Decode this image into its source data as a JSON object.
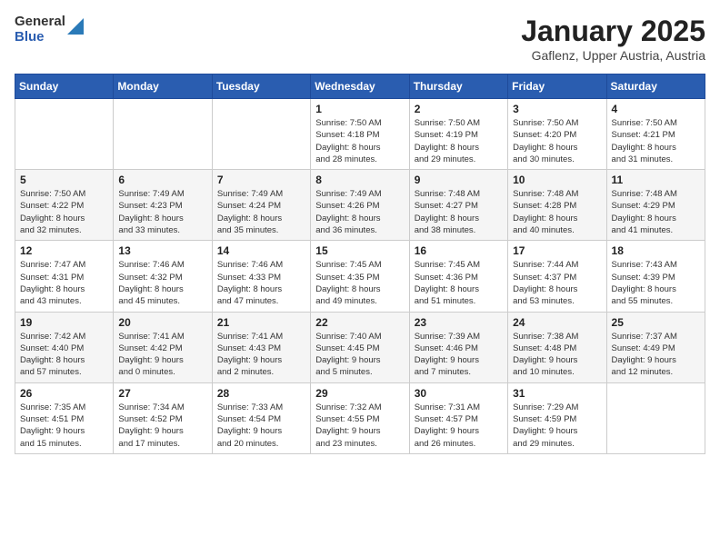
{
  "logo": {
    "general": "General",
    "blue": "Blue"
  },
  "header": {
    "title": "January 2025",
    "subtitle": "Gaflenz, Upper Austria, Austria"
  },
  "days_of_week": [
    "Sunday",
    "Monday",
    "Tuesday",
    "Wednesday",
    "Thursday",
    "Friday",
    "Saturday"
  ],
  "weeks": [
    [
      {
        "day": "",
        "info": ""
      },
      {
        "day": "",
        "info": ""
      },
      {
        "day": "",
        "info": ""
      },
      {
        "day": "1",
        "info": "Sunrise: 7:50 AM\nSunset: 4:18 PM\nDaylight: 8 hours\nand 28 minutes."
      },
      {
        "day": "2",
        "info": "Sunrise: 7:50 AM\nSunset: 4:19 PM\nDaylight: 8 hours\nand 29 minutes."
      },
      {
        "day": "3",
        "info": "Sunrise: 7:50 AM\nSunset: 4:20 PM\nDaylight: 8 hours\nand 30 minutes."
      },
      {
        "day": "4",
        "info": "Sunrise: 7:50 AM\nSunset: 4:21 PM\nDaylight: 8 hours\nand 31 minutes."
      }
    ],
    [
      {
        "day": "5",
        "info": "Sunrise: 7:50 AM\nSunset: 4:22 PM\nDaylight: 8 hours\nand 32 minutes."
      },
      {
        "day": "6",
        "info": "Sunrise: 7:49 AM\nSunset: 4:23 PM\nDaylight: 8 hours\nand 33 minutes."
      },
      {
        "day": "7",
        "info": "Sunrise: 7:49 AM\nSunset: 4:24 PM\nDaylight: 8 hours\nand 35 minutes."
      },
      {
        "day": "8",
        "info": "Sunrise: 7:49 AM\nSunset: 4:26 PM\nDaylight: 8 hours\nand 36 minutes."
      },
      {
        "day": "9",
        "info": "Sunrise: 7:48 AM\nSunset: 4:27 PM\nDaylight: 8 hours\nand 38 minutes."
      },
      {
        "day": "10",
        "info": "Sunrise: 7:48 AM\nSunset: 4:28 PM\nDaylight: 8 hours\nand 40 minutes."
      },
      {
        "day": "11",
        "info": "Sunrise: 7:48 AM\nSunset: 4:29 PM\nDaylight: 8 hours\nand 41 minutes."
      }
    ],
    [
      {
        "day": "12",
        "info": "Sunrise: 7:47 AM\nSunset: 4:31 PM\nDaylight: 8 hours\nand 43 minutes."
      },
      {
        "day": "13",
        "info": "Sunrise: 7:46 AM\nSunset: 4:32 PM\nDaylight: 8 hours\nand 45 minutes."
      },
      {
        "day": "14",
        "info": "Sunrise: 7:46 AM\nSunset: 4:33 PM\nDaylight: 8 hours\nand 47 minutes."
      },
      {
        "day": "15",
        "info": "Sunrise: 7:45 AM\nSunset: 4:35 PM\nDaylight: 8 hours\nand 49 minutes."
      },
      {
        "day": "16",
        "info": "Sunrise: 7:45 AM\nSunset: 4:36 PM\nDaylight: 8 hours\nand 51 minutes."
      },
      {
        "day": "17",
        "info": "Sunrise: 7:44 AM\nSunset: 4:37 PM\nDaylight: 8 hours\nand 53 minutes."
      },
      {
        "day": "18",
        "info": "Sunrise: 7:43 AM\nSunset: 4:39 PM\nDaylight: 8 hours\nand 55 minutes."
      }
    ],
    [
      {
        "day": "19",
        "info": "Sunrise: 7:42 AM\nSunset: 4:40 PM\nDaylight: 8 hours\nand 57 minutes."
      },
      {
        "day": "20",
        "info": "Sunrise: 7:41 AM\nSunset: 4:42 PM\nDaylight: 9 hours\nand 0 minutes."
      },
      {
        "day": "21",
        "info": "Sunrise: 7:41 AM\nSunset: 4:43 PM\nDaylight: 9 hours\nand 2 minutes."
      },
      {
        "day": "22",
        "info": "Sunrise: 7:40 AM\nSunset: 4:45 PM\nDaylight: 9 hours\nand 5 minutes."
      },
      {
        "day": "23",
        "info": "Sunrise: 7:39 AM\nSunset: 4:46 PM\nDaylight: 9 hours\nand 7 minutes."
      },
      {
        "day": "24",
        "info": "Sunrise: 7:38 AM\nSunset: 4:48 PM\nDaylight: 9 hours\nand 10 minutes."
      },
      {
        "day": "25",
        "info": "Sunrise: 7:37 AM\nSunset: 4:49 PM\nDaylight: 9 hours\nand 12 minutes."
      }
    ],
    [
      {
        "day": "26",
        "info": "Sunrise: 7:35 AM\nSunset: 4:51 PM\nDaylight: 9 hours\nand 15 minutes."
      },
      {
        "day": "27",
        "info": "Sunrise: 7:34 AM\nSunset: 4:52 PM\nDaylight: 9 hours\nand 17 minutes."
      },
      {
        "day": "28",
        "info": "Sunrise: 7:33 AM\nSunset: 4:54 PM\nDaylight: 9 hours\nand 20 minutes."
      },
      {
        "day": "29",
        "info": "Sunrise: 7:32 AM\nSunset: 4:55 PM\nDaylight: 9 hours\nand 23 minutes."
      },
      {
        "day": "30",
        "info": "Sunrise: 7:31 AM\nSunset: 4:57 PM\nDaylight: 9 hours\nand 26 minutes."
      },
      {
        "day": "31",
        "info": "Sunrise: 7:29 AM\nSunset: 4:59 PM\nDaylight: 9 hours\nand 29 minutes."
      },
      {
        "day": "",
        "info": ""
      }
    ]
  ]
}
